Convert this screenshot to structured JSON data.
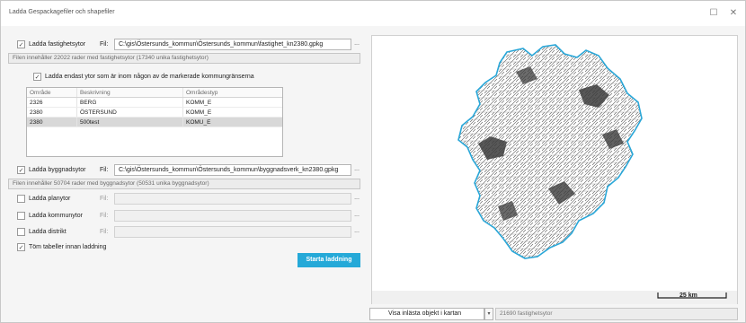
{
  "window": {
    "title": "Ladda Gespackagefiler och shapefiler"
  },
  "fastighet": {
    "label": "Ladda fastighetsytor",
    "fil_label": "Fil:",
    "path": "C:\\gis\\Östersunds_kommun\\Östersunds_kommun\\fastighet_kn2380.gpkg",
    "info": "Filen innehåller 22022 rader med fastighetsytor (17340 unika fastighetsytor)",
    "restrict_label": "Ladda endast ytor som är inom någon av de markerade kommungränserna"
  },
  "table": {
    "headers": [
      "Område",
      "Beskrivning",
      "Områdestyp"
    ],
    "rows": [
      [
        "2326",
        "BERG",
        "KOMM_E"
      ],
      [
        "2380",
        "ÖSTERSUND",
        "KOMM_E"
      ],
      [
        "2380",
        "500test",
        "KOMU_E"
      ]
    ]
  },
  "byggnad": {
    "label": "Ladda byggnadsytor",
    "fil_label": "Fil:",
    "path": "C:\\gis\\Östersunds_kommun\\Östersunds_kommun\\byggnadsverk_kn2380.gpkg",
    "info": "Filen innehåller 50704 rader med byggnadsytor (50531 unika byggnadsytor)"
  },
  "planytor": {
    "label": "Ladda planytor",
    "fil_label": "Fil:"
  },
  "kommunytor": {
    "label": "Ladda kommunytor",
    "fil_label": "Fil:"
  },
  "distrikt": {
    "label": "Ladda distrikt",
    "fil_label": "Fil:"
  },
  "tom": {
    "label": "Töm tabeller innan laddning"
  },
  "start_button": "Starta laddning",
  "map": {
    "scale_label": "25 km"
  },
  "bottom": {
    "dropdown_value": "Visa inlästa objekt i kartan",
    "status": "21690 fastighetsytor"
  },
  "ellipsis": "...",
  "check": "✓"
}
